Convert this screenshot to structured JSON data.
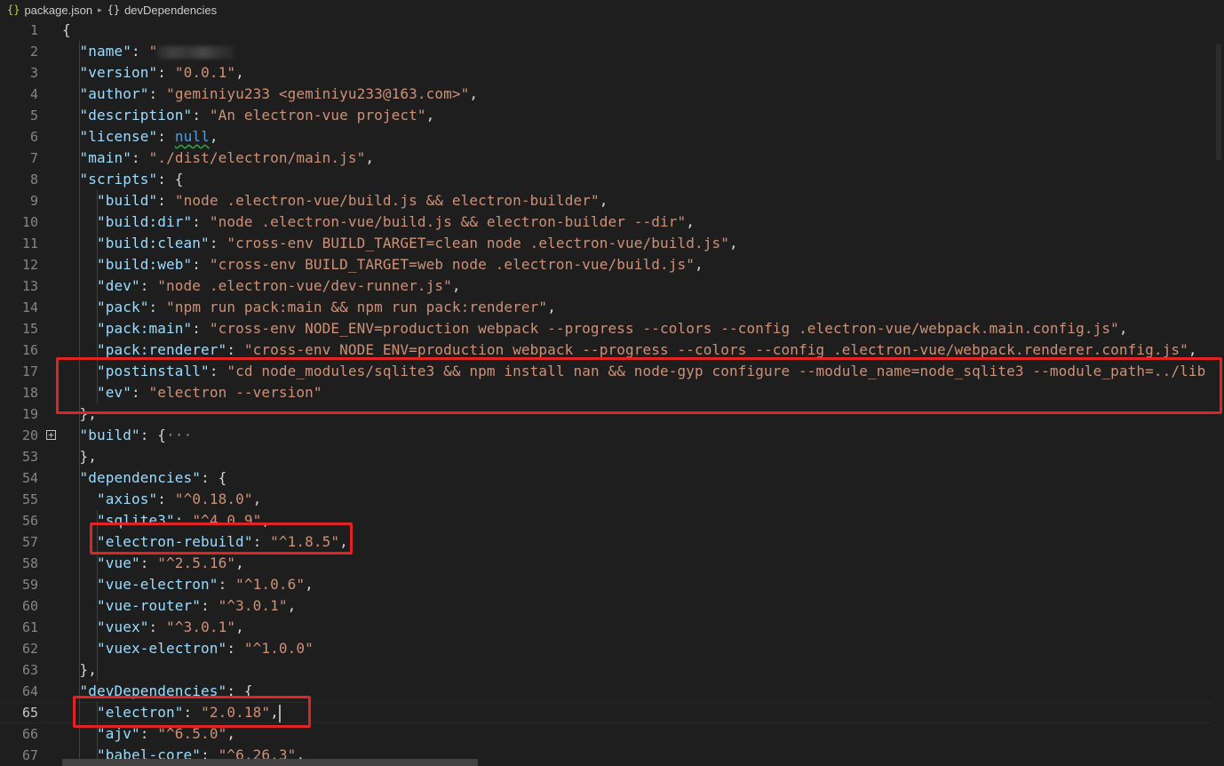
{
  "breadcrumb": {
    "file_icon": "{}",
    "file": "package.json",
    "separator": "▸",
    "node_icon": "{}",
    "node": "devDependencies"
  },
  "lines": [
    {
      "n": "1",
      "parts": [
        [
          "p",
          "{"
        ]
      ]
    },
    {
      "n": "2",
      "parts": [
        [
          "p",
          "  "
        ],
        [
          "k",
          "\"name\""
        ],
        [
          "p",
          ": "
        ],
        [
          "s",
          "\""
        ],
        [
          "redact",
          ""
        ]
      ]
    },
    {
      "n": "3",
      "parts": [
        [
          "p",
          "  "
        ],
        [
          "k",
          "\"version\""
        ],
        [
          "p",
          ": "
        ],
        [
          "s",
          "\"0.0.1\""
        ],
        [
          "p",
          ","
        ]
      ]
    },
    {
      "n": "4",
      "parts": [
        [
          "p",
          "  "
        ],
        [
          "k",
          "\"author\""
        ],
        [
          "p",
          ": "
        ],
        [
          "s",
          "\"geminiyu233 <geminiyu233@163.com>\""
        ],
        [
          "p",
          ","
        ]
      ]
    },
    {
      "n": "5",
      "parts": [
        [
          "p",
          "  "
        ],
        [
          "k",
          "\"description\""
        ],
        [
          "p",
          ": "
        ],
        [
          "s",
          "\"An electron-vue project\""
        ],
        [
          "p",
          ","
        ]
      ]
    },
    {
      "n": "6",
      "parts": [
        [
          "p",
          "  "
        ],
        [
          "k",
          "\"license\""
        ],
        [
          "p",
          ": "
        ],
        [
          "n",
          "null"
        ],
        [
          "p",
          ","
        ]
      ]
    },
    {
      "n": "7",
      "parts": [
        [
          "p",
          "  "
        ],
        [
          "k",
          "\"main\""
        ],
        [
          "p",
          ": "
        ],
        [
          "s",
          "\"./dist/electron/main.js\""
        ],
        [
          "p",
          ","
        ]
      ]
    },
    {
      "n": "8",
      "parts": [
        [
          "p",
          "  "
        ],
        [
          "k",
          "\"scripts\""
        ],
        [
          "p",
          ": {"
        ]
      ]
    },
    {
      "n": "9",
      "parts": [
        [
          "p",
          "    "
        ],
        [
          "k",
          "\"build\""
        ],
        [
          "p",
          ": "
        ],
        [
          "s",
          "\"node .electron-vue/build.js && electron-builder\""
        ],
        [
          "p",
          ","
        ]
      ]
    },
    {
      "n": "10",
      "parts": [
        [
          "p",
          "    "
        ],
        [
          "k",
          "\"build:dir\""
        ],
        [
          "p",
          ": "
        ],
        [
          "s",
          "\"node .electron-vue/build.js && electron-builder --dir\""
        ],
        [
          "p",
          ","
        ]
      ]
    },
    {
      "n": "11",
      "parts": [
        [
          "p",
          "    "
        ],
        [
          "k",
          "\"build:clean\""
        ],
        [
          "p",
          ": "
        ],
        [
          "s",
          "\"cross-env BUILD_TARGET=clean node .electron-vue/build.js\""
        ],
        [
          "p",
          ","
        ]
      ]
    },
    {
      "n": "12",
      "parts": [
        [
          "p",
          "    "
        ],
        [
          "k",
          "\"build:web\""
        ],
        [
          "p",
          ": "
        ],
        [
          "s",
          "\"cross-env BUILD_TARGET=web node .electron-vue/build.js\""
        ],
        [
          "p",
          ","
        ]
      ]
    },
    {
      "n": "13",
      "parts": [
        [
          "p",
          "    "
        ],
        [
          "k",
          "\"dev\""
        ],
        [
          "p",
          ": "
        ],
        [
          "s",
          "\"node .electron-vue/dev-runner.js\""
        ],
        [
          "p",
          ","
        ]
      ]
    },
    {
      "n": "14",
      "parts": [
        [
          "p",
          "    "
        ],
        [
          "k",
          "\"pack\""
        ],
        [
          "p",
          ": "
        ],
        [
          "s",
          "\"npm run pack:main && npm run pack:renderer\""
        ],
        [
          "p",
          ","
        ]
      ]
    },
    {
      "n": "15",
      "parts": [
        [
          "p",
          "    "
        ],
        [
          "k",
          "\"pack:main\""
        ],
        [
          "p",
          ": "
        ],
        [
          "s",
          "\"cross-env NODE_ENV=production webpack --progress --colors --config .electron-vue/webpack.main.config.js\""
        ],
        [
          "p",
          ","
        ]
      ]
    },
    {
      "n": "16",
      "parts": [
        [
          "p",
          "    "
        ],
        [
          "k",
          "\"pack:renderer\""
        ],
        [
          "p",
          ": "
        ],
        [
          "s",
          "\"cross-env NODE_ENV=production webpack --progress --colors --config .electron-vue/webpack.renderer.config.js\""
        ],
        [
          "p",
          ","
        ]
      ]
    },
    {
      "n": "17",
      "parts": [
        [
          "p",
          "    "
        ],
        [
          "k",
          "\"postinstall\""
        ],
        [
          "p",
          ": "
        ],
        [
          "s",
          "\"cd node_modules/sqlite3 && npm install nan && node-gyp configure --module_name=node_sqlite3 --module_path=../lib"
        ]
      ]
    },
    {
      "n": "18",
      "parts": [
        [
          "p",
          "    "
        ],
        [
          "k",
          "\"ev\""
        ],
        [
          "p",
          ": "
        ],
        [
          "s",
          "\"electron --version\""
        ]
      ]
    },
    {
      "n": "19",
      "parts": [
        [
          "p",
          "  },"
        ]
      ]
    },
    {
      "n": "20",
      "fold": true,
      "parts": [
        [
          "p",
          "  "
        ],
        [
          "k",
          "\"build\""
        ],
        [
          "p",
          ": {"
        ],
        [
          "f",
          "···"
        ]
      ]
    },
    {
      "n": "53",
      "parts": [
        [
          "p",
          "  },"
        ]
      ]
    },
    {
      "n": "54",
      "parts": [
        [
          "p",
          "  "
        ],
        [
          "k",
          "\"dependencies\""
        ],
        [
          "p",
          ": {"
        ]
      ]
    },
    {
      "n": "55",
      "parts": [
        [
          "p",
          "    "
        ],
        [
          "k",
          "\"axios\""
        ],
        [
          "p",
          ": "
        ],
        [
          "s",
          "\"^0.18.0\""
        ],
        [
          "p",
          ","
        ]
      ]
    },
    {
      "n": "56",
      "parts": [
        [
          "p",
          "    "
        ],
        [
          "k",
          "\"sqlite3\""
        ],
        [
          "p",
          ": "
        ],
        [
          "s",
          "\"^4.0.9\""
        ],
        [
          "p",
          ","
        ]
      ]
    },
    {
      "n": "57",
      "parts": [
        [
          "p",
          "    "
        ],
        [
          "k",
          "\"electron-rebuild\""
        ],
        [
          "p",
          ": "
        ],
        [
          "s",
          "\"^1.8.5\""
        ],
        [
          "p",
          ","
        ]
      ]
    },
    {
      "n": "58",
      "parts": [
        [
          "p",
          "    "
        ],
        [
          "k",
          "\"vue\""
        ],
        [
          "p",
          ": "
        ],
        [
          "s",
          "\"^2.5.16\""
        ],
        [
          "p",
          ","
        ]
      ]
    },
    {
      "n": "59",
      "parts": [
        [
          "p",
          "    "
        ],
        [
          "k",
          "\"vue-electron\""
        ],
        [
          "p",
          ": "
        ],
        [
          "s",
          "\"^1.0.6\""
        ],
        [
          "p",
          ","
        ]
      ]
    },
    {
      "n": "60",
      "parts": [
        [
          "p",
          "    "
        ],
        [
          "k",
          "\"vue-router\""
        ],
        [
          "p",
          ": "
        ],
        [
          "s",
          "\"^3.0.1\""
        ],
        [
          "p",
          ","
        ]
      ]
    },
    {
      "n": "61",
      "parts": [
        [
          "p",
          "    "
        ],
        [
          "k",
          "\"vuex\""
        ],
        [
          "p",
          ": "
        ],
        [
          "s",
          "\"^3.0.1\""
        ],
        [
          "p",
          ","
        ]
      ]
    },
    {
      "n": "62",
      "parts": [
        [
          "p",
          "    "
        ],
        [
          "k",
          "\"vuex-electron\""
        ],
        [
          "p",
          ": "
        ],
        [
          "s",
          "\"^1.0.0\""
        ]
      ]
    },
    {
      "n": "63",
      "parts": [
        [
          "p",
          "  },"
        ]
      ]
    },
    {
      "n": "64",
      "parts": [
        [
          "p",
          "  "
        ],
        [
          "k",
          "\"devDependencies\""
        ],
        [
          "p",
          ": {"
        ]
      ]
    },
    {
      "n": "65",
      "current": true,
      "parts": [
        [
          "p",
          "    "
        ],
        [
          "k",
          "\"electron\""
        ],
        [
          "p",
          ": "
        ],
        [
          "s",
          "\"2.0.18\""
        ],
        [
          "p",
          ","
        ],
        [
          "cursor",
          ""
        ]
      ]
    },
    {
      "n": "66",
      "parts": [
        [
          "p",
          "    "
        ],
        [
          "k",
          "\"ajv\""
        ],
        [
          "p",
          ": "
        ],
        [
          "s",
          "\"^6.5.0\""
        ],
        [
          "p",
          ","
        ]
      ]
    },
    {
      "n": "67",
      "parts": [
        [
          "p",
          "    "
        ],
        [
          "k",
          "\"babel-core\""
        ],
        [
          "p",
          ": "
        ],
        [
          "s",
          "\"^6.26.3\""
        ],
        [
          "p",
          ","
        ]
      ]
    }
  ],
  "colors": {
    "highlight_box": "#e02323",
    "key": "#9cdcfe",
    "string": "#ce9178",
    "keyword": "#569cd6",
    "background": "#1e1e1e"
  }
}
